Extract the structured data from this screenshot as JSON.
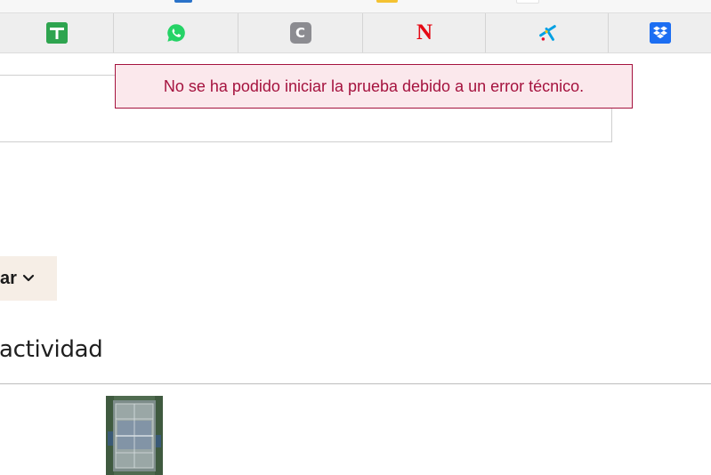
{
  "shortcuts": [
    {
      "name": "sheets-shortcut",
      "icon": "green-plus-icon",
      "glyph": "",
      "color": "#2ea44f"
    },
    {
      "name": "whatsapp-shortcut",
      "icon": "whatsapp-icon",
      "glyph": "",
      "color": "#25d366"
    },
    {
      "name": "c-app-shortcut",
      "icon": "c-letter-icon",
      "glyph": "C",
      "color": "#8c8c91"
    },
    {
      "name": "netflix-shortcut",
      "icon": "netflix-icon",
      "glyph": "N",
      "color": "#e50914"
    },
    {
      "name": "caixabank-shortcut",
      "icon": "caixabank-star-icon",
      "glyph": "",
      "color": "#00a0e3"
    },
    {
      "name": "dropbox-shortcut",
      "icon": "dropbox-icon",
      "glyph": "",
      "color": "#1c6ef2"
    }
  ],
  "error_toast": {
    "message": "No se ha podido iniciar la prueba debido a un error técnico.",
    "color": "#a5123e"
  },
  "sort_button": {
    "label": "ar"
  },
  "section": {
    "heading": "actividad"
  }
}
